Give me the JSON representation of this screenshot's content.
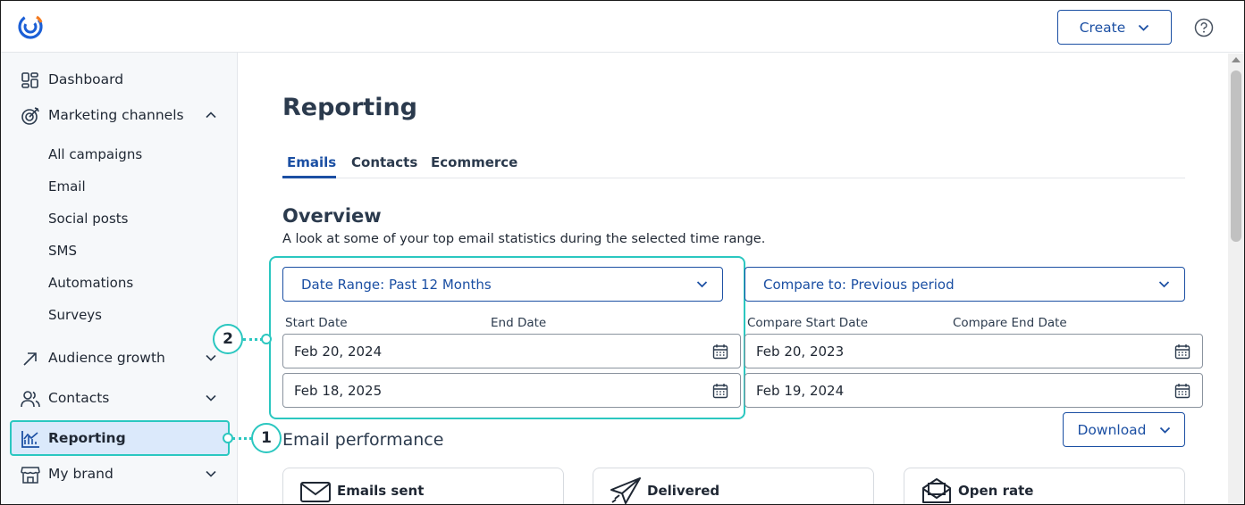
{
  "header": {
    "create_label": "Create",
    "logo_icon": "constant-contact-logo-icon",
    "help_icon": "question-circle-icon"
  },
  "sidebar": {
    "items": [
      {
        "label": "Dashboard",
        "icon": "dashboard-icon"
      },
      {
        "label": "Marketing channels",
        "icon": "target-icon"
      },
      {
        "label": "Audience growth",
        "icon": "arrow-up-right-icon"
      },
      {
        "label": "Contacts",
        "icon": "contacts-icon"
      },
      {
        "label": "Reporting",
        "icon": "bar-chart-icon"
      },
      {
        "label": "My brand",
        "icon": "storefront-icon"
      }
    ],
    "sub_items": [
      "All campaigns",
      "Email",
      "Social posts",
      "SMS",
      "Automations",
      "Surveys"
    ]
  },
  "callouts": {
    "one": "1",
    "two": "2"
  },
  "main": {
    "title": "Reporting",
    "tabs": [
      "Emails",
      "Contacts",
      "Ecommerce"
    ],
    "overview": {
      "title": "Overview",
      "description": "A look at some of your top email statistics during the selected time range."
    },
    "date_range": {
      "label": "Date Range: Past 12 Months",
      "start_label": "Start Date",
      "end_label": "End Date",
      "start_value": "Feb 20, 2024",
      "end_value": "Feb 18, 2025"
    },
    "compare": {
      "label": "Compare to: Previous period",
      "start_label": "Compare Start Date",
      "end_label": "Compare End Date",
      "start_value": "Feb 20, 2023",
      "end_value": "Feb 19, 2024"
    },
    "email_performance": {
      "title": "Email performance",
      "download_label": "Download",
      "cards": [
        {
          "title": "Emails sent",
          "icon": "envelope-icon"
        },
        {
          "title": "Delivered",
          "icon": "paper-plane-icon"
        },
        {
          "title": "Open rate",
          "icon": "open-envelope-icon"
        }
      ]
    }
  },
  "colors": {
    "accent": "#1b4fa3",
    "highlight": "#2bc7c0",
    "sidebar_bg": "#f6f8fa",
    "active_bg": "#dbe9fb"
  }
}
